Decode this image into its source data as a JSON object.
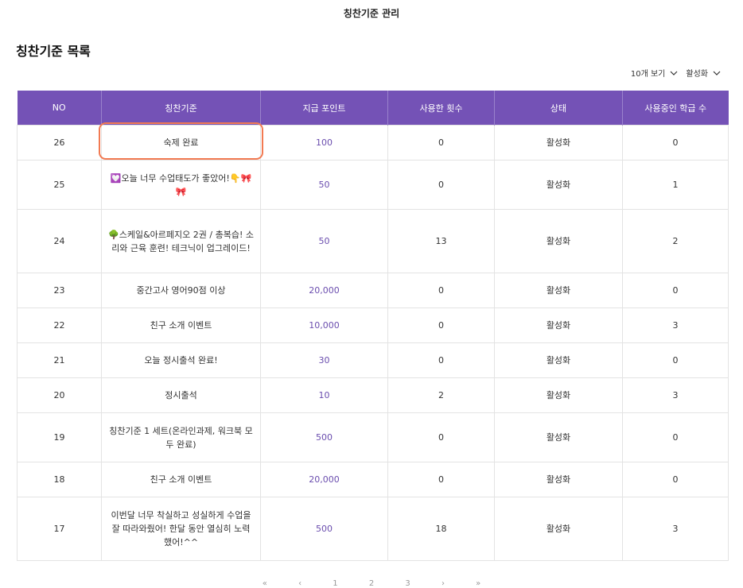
{
  "page": {
    "title": "칭찬기준 관리"
  },
  "section": {
    "title": "칭찬기준 목록"
  },
  "controls": {
    "page_size": "10개 보기",
    "status_filter": "활성화"
  },
  "table": {
    "columns": [
      "NO",
      "칭찬기준",
      "지급 포인트",
      "사용한 횟수",
      "상태",
      "사용중인 학급 수"
    ],
    "rows": [
      {
        "no": "26",
        "criterion": "숙제 완료",
        "points": "100",
        "uses": "0",
        "status": "활성화",
        "classes": "0"
      },
      {
        "no": "25",
        "criterion": "💟오늘 너무 수업태도가 좋았어!👇🎀🎀",
        "points": "50",
        "uses": "0",
        "status": "활성화",
        "classes": "1"
      },
      {
        "no": "24",
        "criterion": "🌳스케일&아르페지오 2권 / 총복습! 소리와 근육 훈련! 테크닉이 업그레이드!",
        "points": "50",
        "uses": "13",
        "status": "활성화",
        "classes": "2"
      },
      {
        "no": "23",
        "criterion": "중간고사 영어90점 이상",
        "points": "20,000",
        "uses": "0",
        "status": "활성화",
        "classes": "0"
      },
      {
        "no": "22",
        "criterion": "친구 소개 이벤트",
        "points": "10,000",
        "uses": "0",
        "status": "활성화",
        "classes": "3"
      },
      {
        "no": "21",
        "criterion": "오늘 정시출석 완료!",
        "points": "30",
        "uses": "0",
        "status": "활성화",
        "classes": "0"
      },
      {
        "no": "20",
        "criterion": "정시출석",
        "points": "10",
        "uses": "2",
        "status": "활성화",
        "classes": "3"
      },
      {
        "no": "19",
        "criterion": "칭찬기준 1 세트(온라인과제, 워크북 모두 완료)",
        "points": "500",
        "uses": "0",
        "status": "활성화",
        "classes": "0"
      },
      {
        "no": "18",
        "criterion": "친구 소개 이벤트",
        "points": "20,000",
        "uses": "0",
        "status": "활성화",
        "classes": "0"
      },
      {
        "no": "17",
        "criterion": "이번달 너무 착실하고 성실하게 수업을 잘 따라와줬어! 한달 동안 열심히 노력했어!^^",
        "points": "500",
        "uses": "18",
        "status": "활성화",
        "classes": "3"
      }
    ]
  },
  "pagination": {
    "first": "«",
    "prev": "‹",
    "pages": [
      "1",
      "2",
      "3"
    ],
    "next": "›",
    "last": "»"
  },
  "colors": {
    "header_bg": "#7452b6",
    "points_text": "#6a4dae",
    "highlight_border": "#f27a52"
  },
  "icons": {
    "dropdown": "chevron-down-icon"
  }
}
